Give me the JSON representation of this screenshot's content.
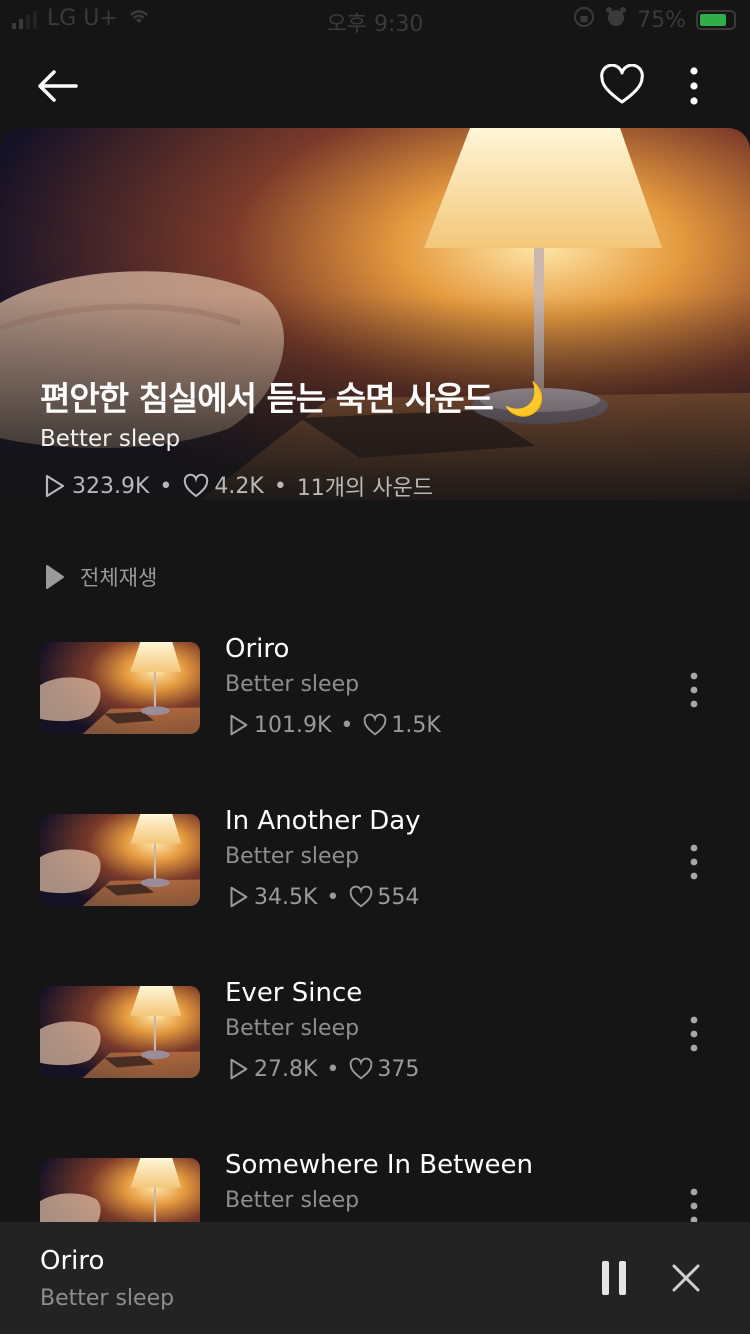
{
  "status_bar": {
    "carrier": "LG U+",
    "time": "오후 9:30",
    "battery": "75%"
  },
  "header": {
    "back_icon": "arrow-left-icon",
    "like_icon": "heart-icon",
    "more_icon": "vertical-dots-icon"
  },
  "playlist": {
    "title": "편안한 침실에서 듣는 숙면 사운드 🌙",
    "artist": "Better sleep",
    "plays": "323.9K",
    "likes": "4.2K",
    "sound_count": "11개의 사운드",
    "play_all_label": "전체재생"
  },
  "tracks": [
    {
      "title": "Oriro",
      "artist": "Better sleep",
      "plays": "101.9K",
      "likes": "1.5K"
    },
    {
      "title": "In Another Day",
      "artist": "Better sleep",
      "plays": "34.5K",
      "likes": "554"
    },
    {
      "title": "Ever Since",
      "artist": "Better sleep",
      "plays": "27.8K",
      "likes": "375"
    },
    {
      "title": "Somewhere In Between",
      "artist": "Better sleep",
      "plays": "",
      "likes": ""
    }
  ],
  "now_playing": {
    "title": "Oriro",
    "artist": "Better sleep",
    "pause_icon": "pause-icon",
    "close_icon": "close-icon"
  },
  "colors": {
    "background": "#151515",
    "player_bar": "#232323",
    "lamp_glow": "#f7c36a",
    "muted_text": "#8e8e8e"
  }
}
